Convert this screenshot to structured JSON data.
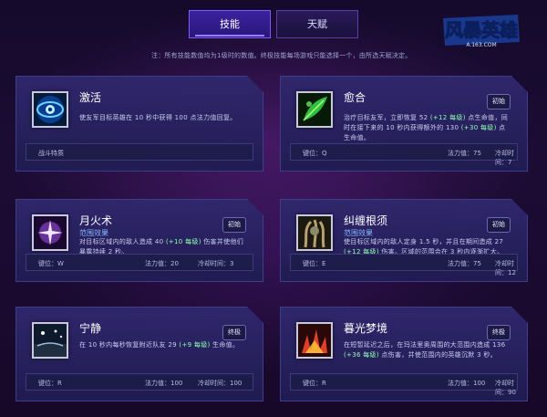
{
  "tabs": [
    {
      "label": "技能",
      "active": true
    },
    {
      "label": "天赋",
      "active": false
    }
  ],
  "logo": {
    "text": "风暴英雄",
    "url_text": "A.163.COM"
  },
  "note": "注：所有技能数值均为1级时的数值。终极技能每场游戏只能选择一个，由所选天赋决定。",
  "cards": {
    "activate": {
      "name": "激活",
      "desc": "使友军目标英雄在 10 秒中获得 100 点法力值回复。",
      "trait_label": "战斗特质",
      "icon": "eye-icon"
    },
    "heal": {
      "name": "愈合",
      "badge": "初始",
      "desc_pre": "治疗目标友军，立即恢复 52 ",
      "desc_hl1": "(+12 每级)",
      "desc_mid": " 点生命值，同时在接下来的 10 秒内获得额外的 130 ",
      "desc_hl2": "(+30 每级)",
      "desc_post": " 点生命值。",
      "key": "键位：Q",
      "mana": "法力值：75",
      "cooldown": "冷却时间：7",
      "icon": "leaf-icon"
    },
    "moonfire": {
      "name": "月火术",
      "badge": "初始",
      "sub": "范围效果",
      "desc_pre": "对目标区域内的敌人造成 40 ",
      "desc_hl1": "(+10 每级)",
      "desc_post": " 伤害并使他们暴露持续 2 秒。",
      "key": "键位：W",
      "mana": "法力值：20",
      "cooldown": "冷却时间：3",
      "icon": "moon-spark-icon"
    },
    "roots": {
      "name": "纠缠根须",
      "badge": "初始",
      "sub": "范围效果",
      "desc_pre": "使目标区域内的敌人定身 1.5 秒，并且在期间造成 27 ",
      "desc_hl1": "(+12 每级)",
      "desc_post": " 伤害。区域的范围会在 3 秒内逐渐扩大。",
      "key": "键位：E",
      "mana": "法力值：75",
      "cooldown": "冷却时间：12",
      "icon": "roots-icon"
    },
    "tranquility": {
      "name": "宁静",
      "badge": "终极",
      "desc_pre": "在 10 秒内每秒恢复附近队友 29 ",
      "desc_hl1": "(+9 每级)",
      "desc_post": " 生命值。",
      "key": "键位：R",
      "mana": "法力值：100",
      "cooldown": "冷却时间：100",
      "icon": "tranquility-icon"
    },
    "twilight": {
      "name": "暮光梦境",
      "badge": "终极",
      "desc_pre": "在短暂延迟之后，在玛法里奥周围的大范围内造成 136 ",
      "desc_hl1": "(+36 每级)",
      "desc_post": " 点伤害，并使范围内的英雄沉默 3 秒。",
      "key": "键位：R",
      "mana": "法力值：100",
      "cooldown": "冷却时间：90",
      "icon": "dream-icon"
    }
  }
}
